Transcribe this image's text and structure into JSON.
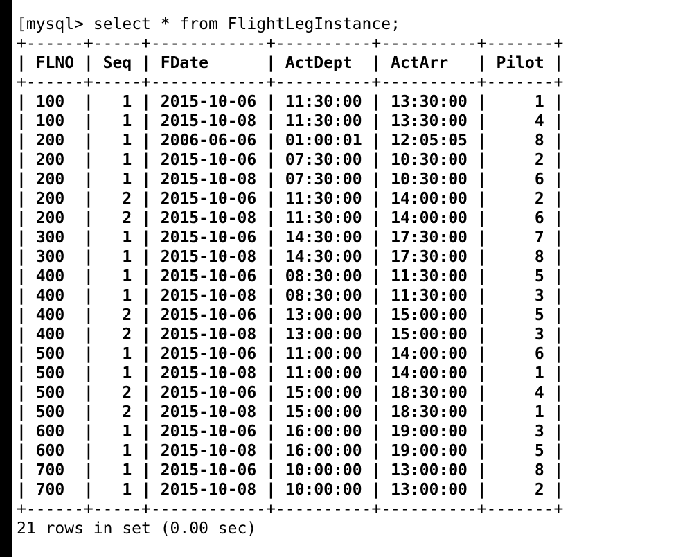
{
  "terminal": {
    "prompt": "mysql>",
    "command": "select * from FlightLegInstance;",
    "columns": [
      "FLNO",
      "Seq",
      "FDate",
      "ActDept",
      "ActArr",
      "Pilot"
    ],
    "rows": [
      [
        "100",
        "1",
        "2015-10-06",
        "11:30:00",
        "13:30:00",
        "1"
      ],
      [
        "100",
        "1",
        "2015-10-08",
        "11:30:00",
        "13:30:00",
        "4"
      ],
      [
        "200",
        "1",
        "2006-06-06",
        "01:00:01",
        "12:05:05",
        "8"
      ],
      [
        "200",
        "1",
        "2015-10-06",
        "07:30:00",
        "10:30:00",
        "2"
      ],
      [
        "200",
        "1",
        "2015-10-08",
        "07:30:00",
        "10:30:00",
        "6"
      ],
      [
        "200",
        "2",
        "2015-10-06",
        "11:30:00",
        "14:00:00",
        "2"
      ],
      [
        "200",
        "2",
        "2015-10-08",
        "11:30:00",
        "14:00:00",
        "6"
      ],
      [
        "300",
        "1",
        "2015-10-06",
        "14:30:00",
        "17:30:00",
        "7"
      ],
      [
        "300",
        "1",
        "2015-10-08",
        "14:30:00",
        "17:30:00",
        "8"
      ],
      [
        "400",
        "1",
        "2015-10-06",
        "08:30:00",
        "11:30:00",
        "5"
      ],
      [
        "400",
        "1",
        "2015-10-08",
        "08:30:00",
        "11:30:00",
        "3"
      ],
      [
        "400",
        "2",
        "2015-10-06",
        "13:00:00",
        "15:00:00",
        "5"
      ],
      [
        "400",
        "2",
        "2015-10-08",
        "13:00:00",
        "15:00:00",
        "3"
      ],
      [
        "500",
        "1",
        "2015-10-06",
        "11:00:00",
        "14:00:00",
        "6"
      ],
      [
        "500",
        "1",
        "2015-10-08",
        "11:00:00",
        "14:00:00",
        "1"
      ],
      [
        "500",
        "2",
        "2015-10-06",
        "15:00:00",
        "18:30:00",
        "4"
      ],
      [
        "500",
        "2",
        "2015-10-08",
        "15:00:00",
        "18:30:00",
        "1"
      ],
      [
        "600",
        "1",
        "2015-10-06",
        "16:00:00",
        "19:00:00",
        "3"
      ],
      [
        "600",
        "1",
        "2015-10-08",
        "16:00:00",
        "19:00:00",
        "5"
      ],
      [
        "700",
        "1",
        "2015-10-06",
        "10:00:00",
        "13:00:00",
        "8"
      ],
      [
        "700",
        "1",
        "2015-10-08",
        "10:00:00",
        "13:00:00",
        "2"
      ]
    ],
    "status": "21 rows in set (0.00 sec)"
  }
}
